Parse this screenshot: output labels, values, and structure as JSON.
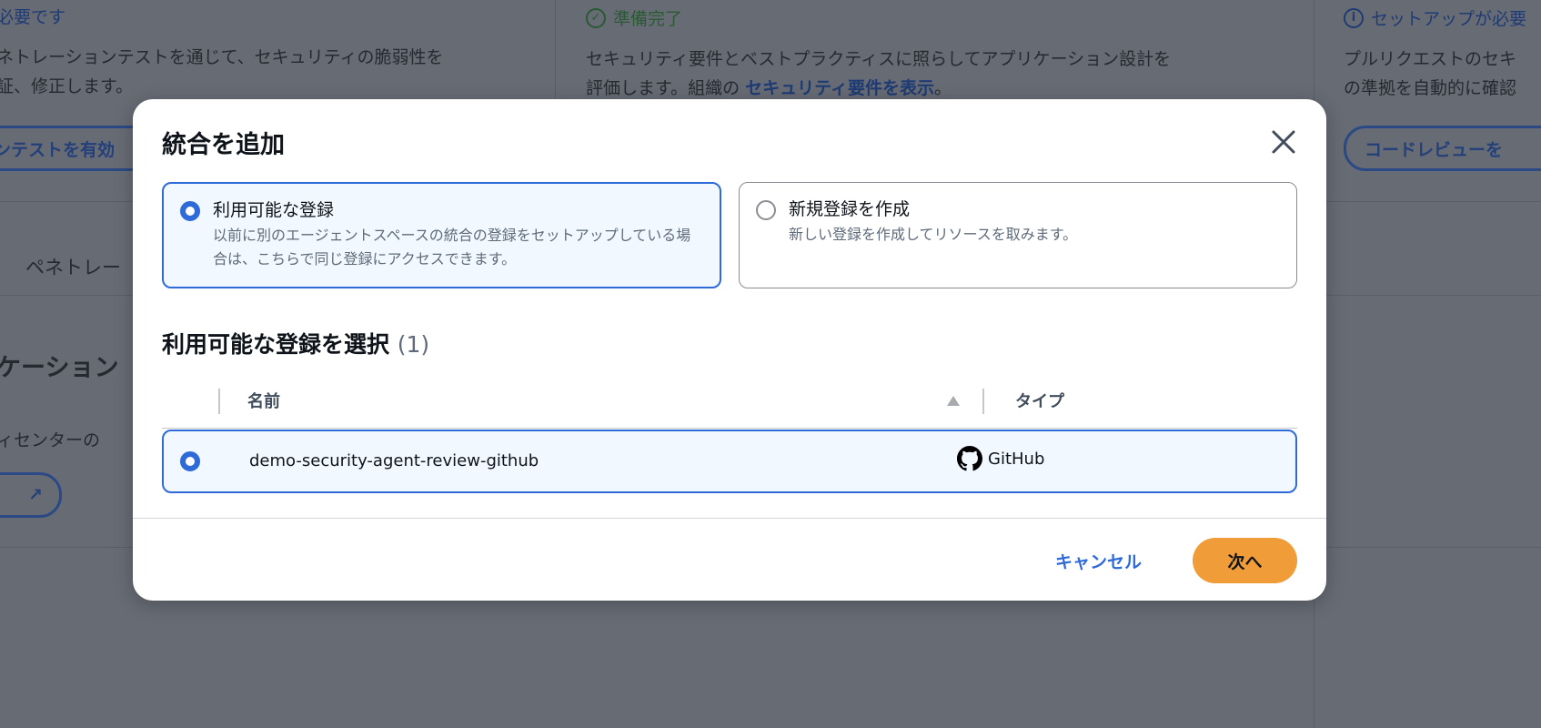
{
  "background": {
    "col1": {
      "status": "必要です",
      "desc_line1": "ネトレーションテストを通じて、セキュリティの脆弱性を",
      "desc_line2": "証、修正します。",
      "button": "ンテストを有効",
      "tab": "ペネトレー",
      "section_title": "ケーション",
      "section_desc": "ィセンターの"
    },
    "col2": {
      "status": "準備完了",
      "desc_line1": "セキュリティ要件とベストプラクティスに照らしてアプリケーション設計を",
      "desc_line2_prefix": "評価します。組織の ",
      "desc_link": "セキュリティ要件を表示",
      "desc_suffix": "。"
    },
    "col3": {
      "status": "セットアップが必要",
      "desc_line1": "プルリクエストのセキ",
      "desc_line2": "の準拠を自動的に確認",
      "button": "コードレビューを"
    }
  },
  "modal": {
    "title": "統合を追加",
    "options": [
      {
        "label": "利用可能な登録",
        "description": "以前に別のエージェントスペースの統合の登録をセットアップしている場合は、こちらで同じ登録にアクセスできます。",
        "selected": true
      },
      {
        "label": "新規登録を作成",
        "description": "新しい登録を作成してリソースを取みます。",
        "selected": false
      }
    ],
    "section_title": "利用可能な登録を選択",
    "section_count": "(1)",
    "table": {
      "columns": [
        "名前",
        "タイプ"
      ],
      "sort": "ascending",
      "rows": [
        {
          "name": "demo-security-agent-review-github",
          "type": "GitHub",
          "selected": true
        }
      ]
    },
    "cancel_label": "キャンセル",
    "next_label": "次へ"
  },
  "colors": {
    "accent": "#2f6bd8",
    "primary_button": "#f09c38",
    "overlay": "#676b74"
  }
}
